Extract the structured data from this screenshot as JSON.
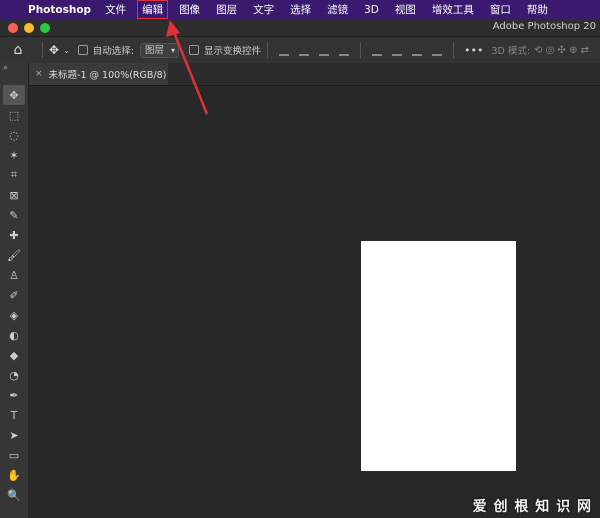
{
  "menubar": {
    "app": "Photoshop",
    "items": [
      "文件",
      "编辑",
      "图像",
      "图层",
      "文字",
      "选择",
      "滤镜",
      "3D",
      "视图",
      "增效工具",
      "窗口",
      "帮助"
    ]
  },
  "window": {
    "title": "Adobe Photoshop 20",
    "dots": [
      "#fe5f57",
      "#febc2e",
      "#28c840"
    ]
  },
  "options": {
    "auto_select_label": "自动选择:",
    "auto_select_value": "图层",
    "show_transform_label": "显示变换控件",
    "mode_3d_label": "3D 模式:"
  },
  "document": {
    "tab_label": "未标题-1 @ 100%(RGB/8)",
    "close_glyph": "×"
  },
  "tools": [
    "✥",
    "⬚",
    "◌",
    "✶",
    "⌗",
    "⊠",
    "✎",
    "✚",
    "🖌",
    "♙",
    "✐",
    "◈",
    "◐",
    "◆",
    "◔",
    "✒",
    "T",
    "➤",
    "▭",
    "✋",
    "🔍"
  ],
  "accent": "#e0303a",
  "watermark": "爱 创 根 知 识 网"
}
